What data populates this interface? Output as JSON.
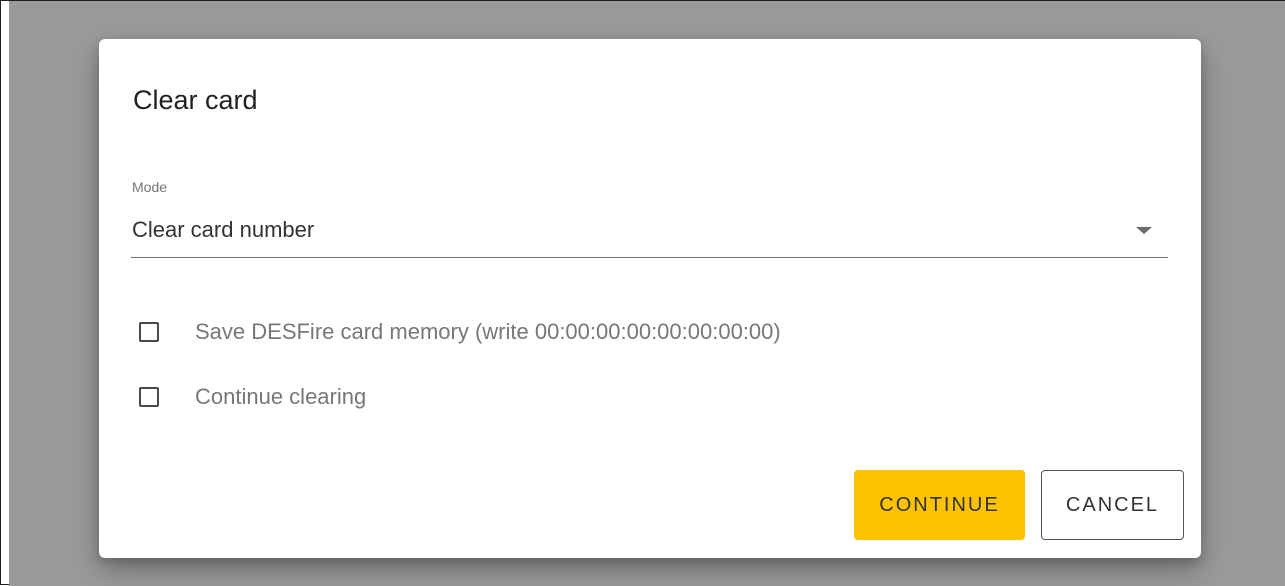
{
  "dialog": {
    "title": "Clear card",
    "mode": {
      "label": "Mode",
      "value": "Clear card number"
    },
    "options": [
      {
        "label": "Save DESFire card memory (write 00:00:00:00:00:00:00:00)",
        "checked": false
      },
      {
        "label": "Continue clearing",
        "checked": false
      }
    ],
    "buttons": {
      "continue_label": "CONTINUE",
      "cancel_label": "CANCEL"
    }
  },
  "colors": {
    "accent": "#fdc300",
    "overlay": "#9a9a9a"
  }
}
